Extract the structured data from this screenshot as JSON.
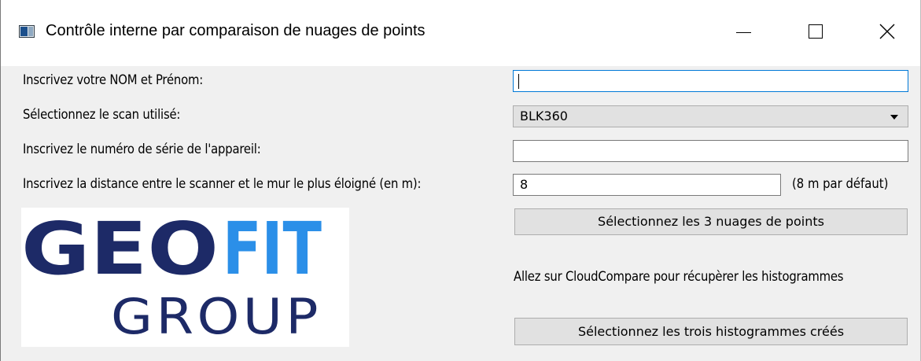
{
  "window": {
    "title": "Contrôle interne par comparaison de nuages de points"
  },
  "form": {
    "name_label": "Inscrivez votre NOM et Prénom:",
    "name_value": "",
    "scan_label": "Sélectionnez le scan utilisé:",
    "scan_selected": "BLK360",
    "serial_label": "Inscrivez le numéro de série de l'appareil:",
    "serial_value": "",
    "distance_label": "Inscrivez la distance entre le scanner et le mur le plus éloigné (en m):",
    "distance_value": "8",
    "distance_hint": "(8 m par défaut)"
  },
  "actions": {
    "select_clouds_label": "Sélectionnez les 3 nuages de points",
    "cloudcompare_info": "Allez sur CloudCompare pour récupèrer les histogrammes",
    "select_histograms_label": "Sélectionnez les trois histogrammes créés"
  },
  "logo": {
    "word_part1": "GEO",
    "word_part2": "FIT",
    "word_line2": "GROUP",
    "colors": {
      "dark": "#1d2a67",
      "accent": "#2b8fe8"
    }
  },
  "colors": {
    "focus_border": "#0078d7",
    "button_bg": "#e1e1e1",
    "panel_bg": "#f0f0f0"
  }
}
